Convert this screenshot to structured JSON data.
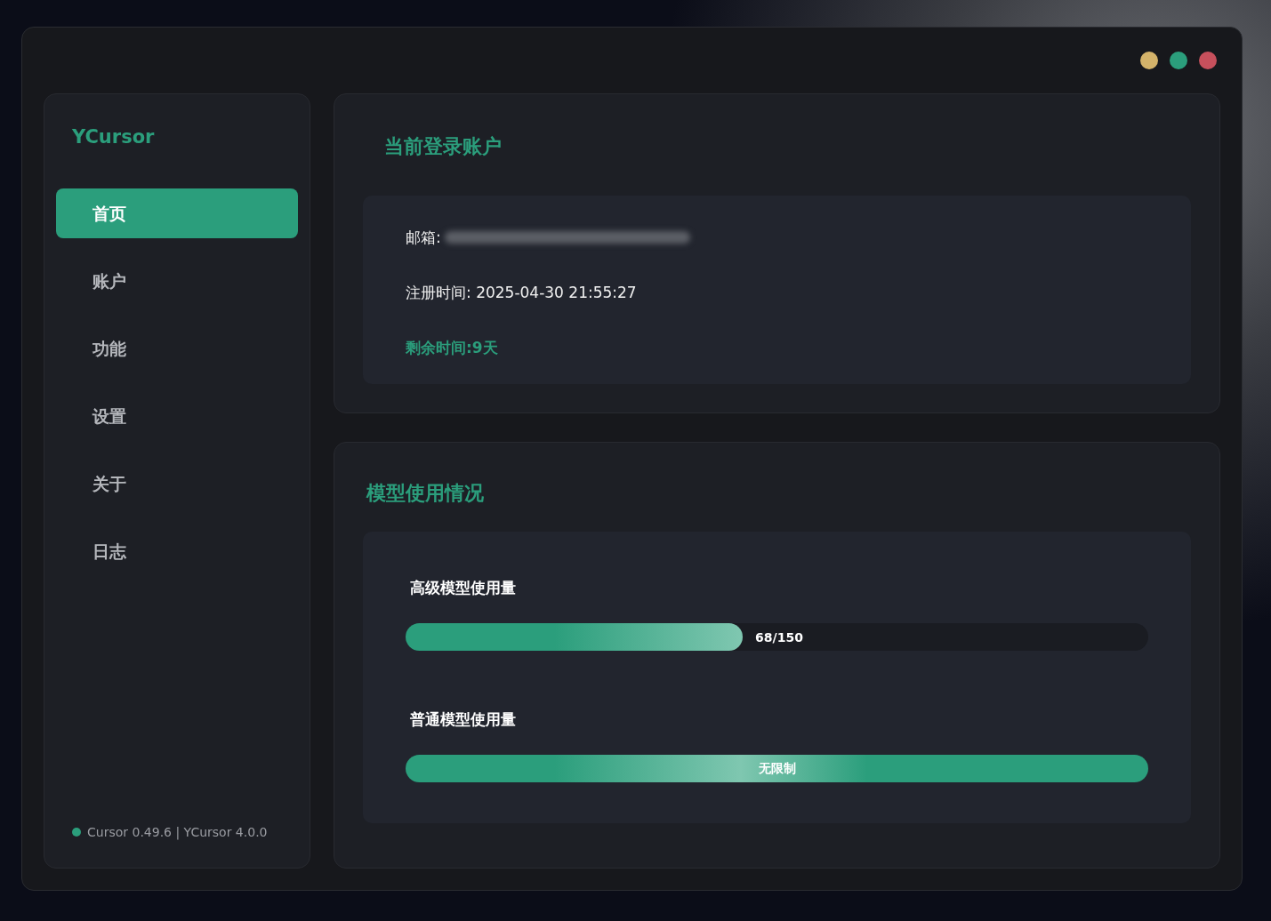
{
  "window": {
    "controls": [
      {
        "color": "#d4b36a"
      },
      {
        "color": "#2b9e7c"
      },
      {
        "color": "#c7505c"
      }
    ]
  },
  "sidebar": {
    "logo": "YCursor",
    "items": [
      {
        "label": "首页",
        "selected": true
      },
      {
        "label": "账户",
        "selected": false
      },
      {
        "label": "功能",
        "selected": false
      },
      {
        "label": "设置",
        "selected": false
      },
      {
        "label": "关于",
        "selected": false
      },
      {
        "label": "日志",
        "selected": false
      }
    ],
    "status": {
      "text": "Cursor 0.49.6 | YCursor 4.0.0",
      "color": "#2b9e7c"
    }
  },
  "account": {
    "title": "当前登录账户",
    "email_label": "邮箱:",
    "email_redacted": true,
    "registered": "注册时间: 2025-04-30 21:55:27",
    "remaining": "剩余时间:9天"
  },
  "usage": {
    "title": "模型使用情况",
    "meters": [
      {
        "label": "高级模型使用量",
        "level": 0.454,
        "reading": "68/150",
        "kind": "count"
      },
      {
        "label": "普通模型使用量",
        "level": 1,
        "reading": "无限制",
        "kind": "unlimited"
      }
    ]
  }
}
